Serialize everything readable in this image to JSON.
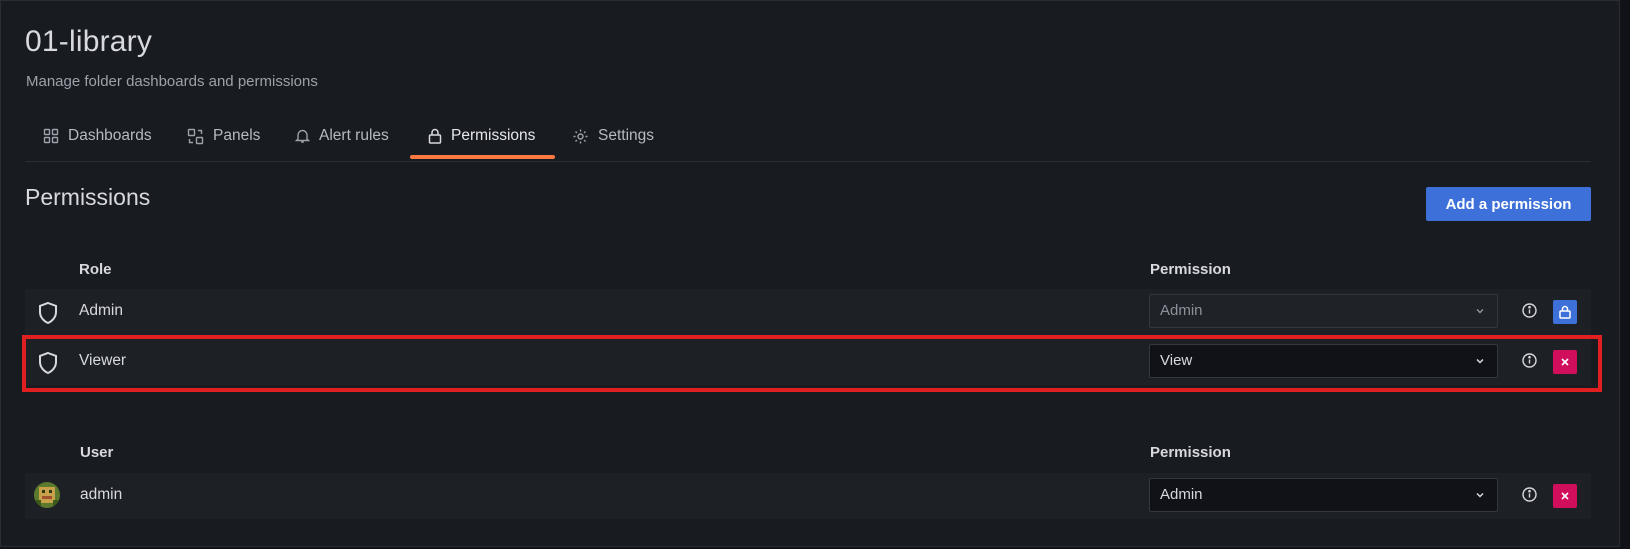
{
  "folder": {
    "title": "01-library",
    "subtitle": "Manage folder dashboards and permissions"
  },
  "tabs": [
    {
      "label": "Dashboards",
      "icon": "apps-icon",
      "active": false
    },
    {
      "label": "Panels",
      "icon": "library-panel-icon",
      "active": false
    },
    {
      "label": "Alert rules",
      "icon": "bell-icon",
      "active": false
    },
    {
      "label": "Permissions",
      "icon": "lock-icon",
      "active": true
    },
    {
      "label": "Settings",
      "icon": "cog-icon",
      "active": false
    }
  ],
  "permissions": {
    "title": "Permissions",
    "add_button": "Add a permission",
    "roles": {
      "col_role": "Role",
      "col_permission": "Permission",
      "items": [
        {
          "name": "Admin",
          "permission": "Admin",
          "icon": "shield-icon",
          "locked": true
        },
        {
          "name": "Viewer",
          "permission": "View",
          "icon": "shield-icon",
          "locked": false
        }
      ]
    },
    "users": {
      "col_user": "User",
      "col_permission": "Permission",
      "items": [
        {
          "name": "admin",
          "permission": "Admin",
          "icon": "avatar"
        }
      ]
    }
  },
  "colors": {
    "accent": "#ff7941",
    "primary": "#3d71d9",
    "destructive": "#d10e5c",
    "highlight": "#e02020"
  }
}
